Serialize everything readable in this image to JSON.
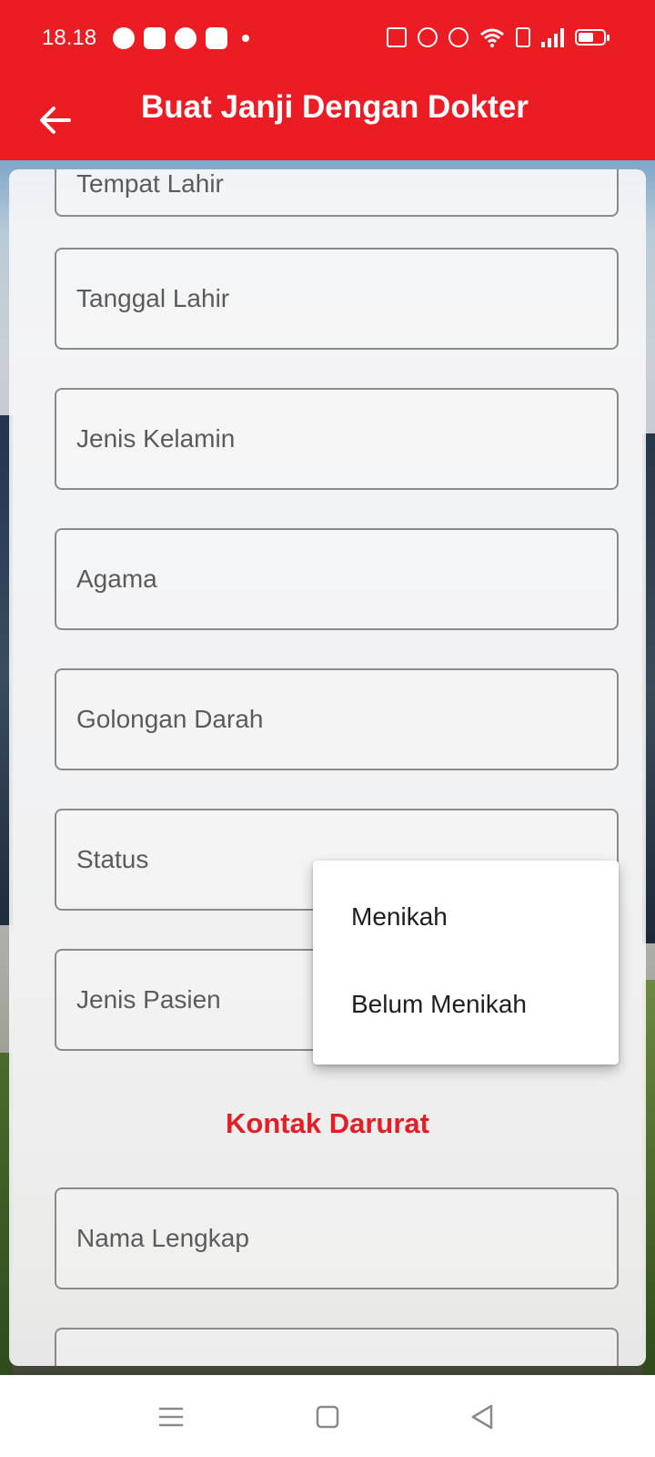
{
  "status_bar": {
    "time": "18.18",
    "notification_icons": [
      "line-icon",
      "game-controller-icon",
      "chat-bubble-icon",
      "app-f-icon",
      "more-dot-icon"
    ],
    "system_icons": [
      "vibrate-icon",
      "alarm-icon",
      "location-icon",
      "wifi-icon",
      "volte-icon",
      "signal-icon",
      "battery-icon"
    ]
  },
  "app_bar": {
    "title": "Buat Janji Dengan Dokter",
    "back_icon": "arrow-left-icon"
  },
  "form": {
    "fields": [
      {
        "label": "Tempat Lahir"
      },
      {
        "label": "Tanggal Lahir"
      },
      {
        "label": "Jenis Kelamin"
      },
      {
        "label": "Agama"
      },
      {
        "label": "Golongan Darah"
      },
      {
        "label": "Status"
      },
      {
        "label": "Jenis Pasien"
      }
    ],
    "emergency_section_title": "Kontak Darurat",
    "emergency_fields": [
      {
        "label": "Nama Lengkap"
      },
      {
        "label": ""
      }
    ]
  },
  "status_dropdown": {
    "options": [
      "Menikah",
      "Belum Menikah"
    ]
  },
  "nav_bar": {
    "icons": [
      "menu-icon",
      "home-square-icon",
      "back-triangle-icon"
    ]
  },
  "colors": {
    "primary": "#ec1c24",
    "section_title": "#e21f26",
    "field_border": "#8a8a8a",
    "label_text": "#5b5b5b"
  }
}
